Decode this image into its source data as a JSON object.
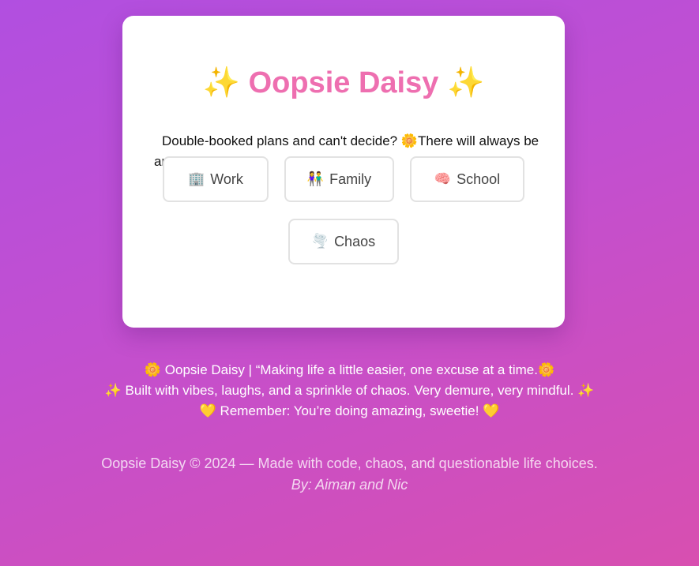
{
  "card": {
    "title_sparkle_left": "✨",
    "title_text": "Oopsie Daisy",
    "title_sparkle_right": "✨",
    "tagline_part1": "Double-booked plans and can't decide?",
    "tagline_emoji": "🌼",
    "tagline_part2": "There will always be an excuse for that."
  },
  "categories": [
    {
      "icon": "🏢",
      "label": "Work"
    },
    {
      "icon": "👫",
      "label": "Family"
    },
    {
      "icon": "🧠",
      "label": "School"
    },
    {
      "icon": "🌪️",
      "label": "Chaos"
    }
  ],
  "footer": {
    "quote_emoji_left": "🌼",
    "quote_text": "Oopsie Daisy | “Making life a little easier, one excuse at a time.",
    "quote_emoji_right": "🌼",
    "vibes_emoji_left": "✨",
    "vibes_text": "Built with vibes, laughs, and a sprinkle of chaos. Very demure, very mindful.",
    "vibes_emoji_right": "✨",
    "amazing_emoji_left": "💛",
    "amazing_text": "Remember: You’re doing amazing, sweetie!",
    "amazing_emoji_right": "💛",
    "copyright": "Oopsie Daisy © 2024 — Made with code, chaos, and questionable life choices.",
    "byline": "By: Aiman and Nic"
  },
  "colors": {
    "title_pink": "#ee6fb0",
    "sparkle_gold": "#f5c518",
    "background_start": "#b14fe0",
    "background_end": "#d84fb0"
  }
}
